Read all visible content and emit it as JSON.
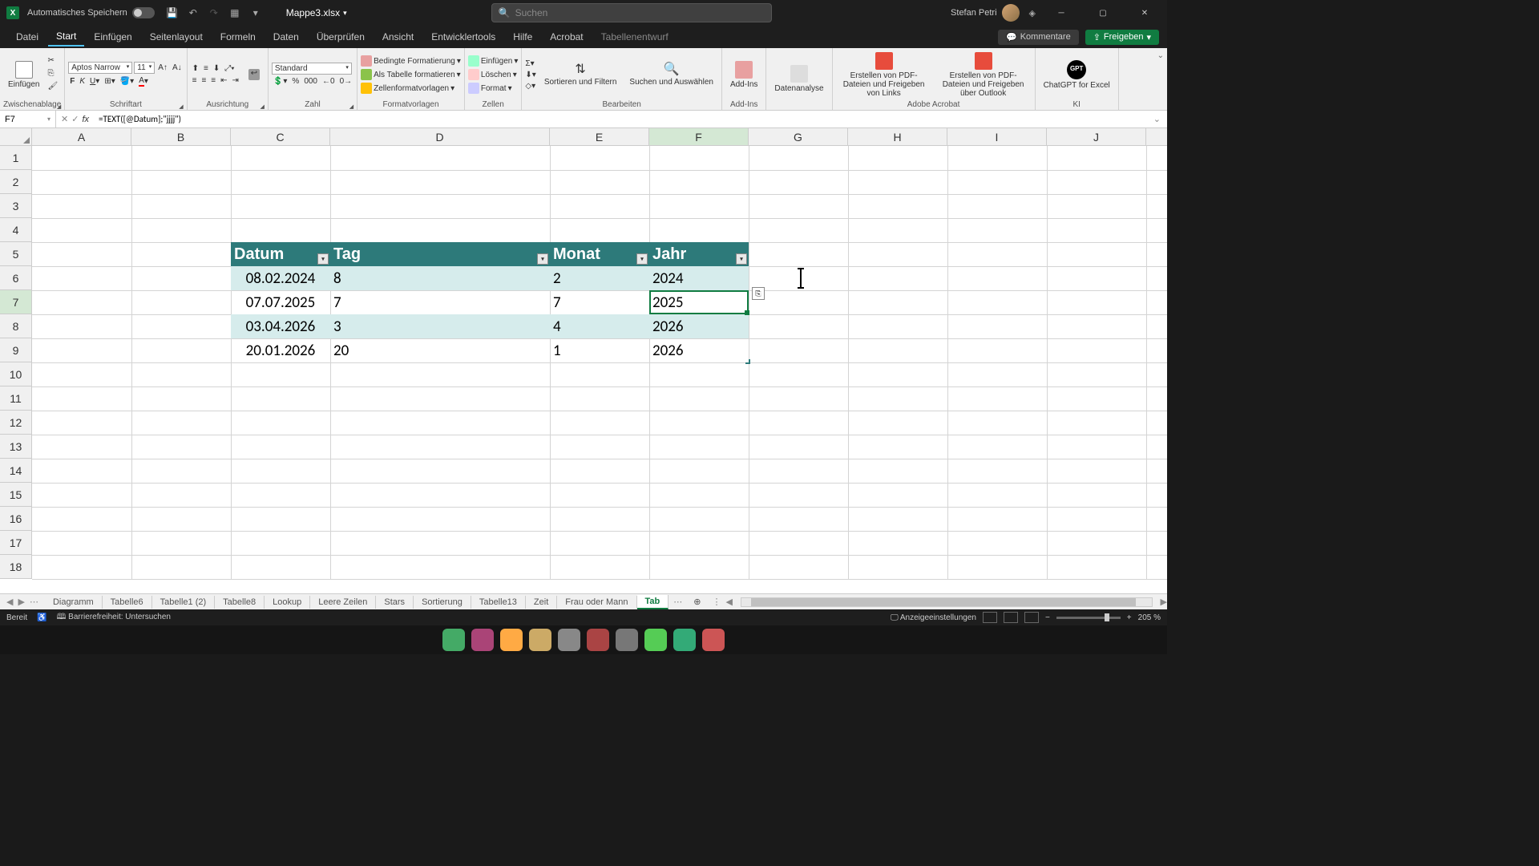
{
  "titlebar": {
    "autosave_label": "Automatisches Speichern",
    "doc_name": "Mappe3.xlsx",
    "search_placeholder": "Suchen",
    "user_name": "Stefan Petri"
  },
  "tabs": {
    "datei": "Datei",
    "start": "Start",
    "einfuegen": "Einfügen",
    "seitenlayout": "Seitenlayout",
    "formeln": "Formeln",
    "daten": "Daten",
    "ueberpruefen": "Überprüfen",
    "ansicht": "Ansicht",
    "entwicklertools": "Entwicklertools",
    "hilfe": "Hilfe",
    "acrobat": "Acrobat",
    "tabellenentwurf": "Tabellenentwurf",
    "kommentare": "Kommentare",
    "freigeben": "Freigeben"
  },
  "ribbon": {
    "zwischenablage": "Zwischenablage",
    "einfuegen_btn": "Einfügen",
    "schriftart": "Schriftart",
    "font_name": "Aptos Narrow",
    "font_size": "11",
    "ausrichtung": "Ausrichtung",
    "zahl": "Zahl",
    "zahl_format": "Standard",
    "formatvorlagen": "Formatvorlagen",
    "bedingte": "Bedingte Formatierung",
    "als_tabelle": "Als Tabelle formatieren",
    "zellenformat": "Zellenformatvorlagen",
    "zellen": "Zellen",
    "zellen_einfuegen": "Einfügen",
    "zellen_loeschen": "Löschen",
    "zellen_format": "Format",
    "bearbeiten": "Bearbeiten",
    "sortieren": "Sortieren und Filtern",
    "suchen": "Suchen und Auswählen",
    "addins_label": "Add-Ins",
    "addins_btn": "Add-Ins",
    "datenanalyse": "Datenanalyse",
    "acrobat_group": "Adobe Acrobat",
    "pdf1": "Erstellen von PDF-Dateien und Freigeben von Links",
    "pdf2": "Erstellen von PDF-Dateien und Freigeben über Outlook",
    "ki": "KI",
    "chatgpt": "ChatGPT for Excel"
  },
  "formula": {
    "cell_ref": "F7",
    "content": "=TEXT([@Datum];\"jjjj\")"
  },
  "columns": [
    "A",
    "B",
    "C",
    "D",
    "E",
    "F",
    "G",
    "H",
    "I",
    "J"
  ],
  "table": {
    "headers": {
      "datum": "Datum",
      "tag": "Tag",
      "monat": "Monat",
      "jahr": "Jahr"
    },
    "rows": [
      {
        "datum": "08.02.2024",
        "tag": "8",
        "monat": "2",
        "jahr": "2024"
      },
      {
        "datum": "07.07.2025",
        "tag": "7",
        "monat": "7",
        "jahr": "2025"
      },
      {
        "datum": "03.04.2026",
        "tag": "3",
        "monat": "4",
        "jahr": "2026"
      },
      {
        "datum": "20.01.2026",
        "tag": "20",
        "monat": "1",
        "jahr": "2026"
      }
    ]
  },
  "sheets": [
    "Diagramm",
    "Tabelle6",
    "Tabelle1 (2)",
    "Tabelle8",
    "Lookup",
    "Leere Zeilen",
    "Stars",
    "Sortierung",
    "Tabelle13",
    "Zeit",
    "Frau oder Mann"
  ],
  "sheet_active": "Tab",
  "status": {
    "bereit": "Bereit",
    "barrierefreiheit": "Barrierefreiheit: Untersuchen",
    "anzeige": "Anzeigeeinstellungen",
    "zoom": "205 %"
  }
}
